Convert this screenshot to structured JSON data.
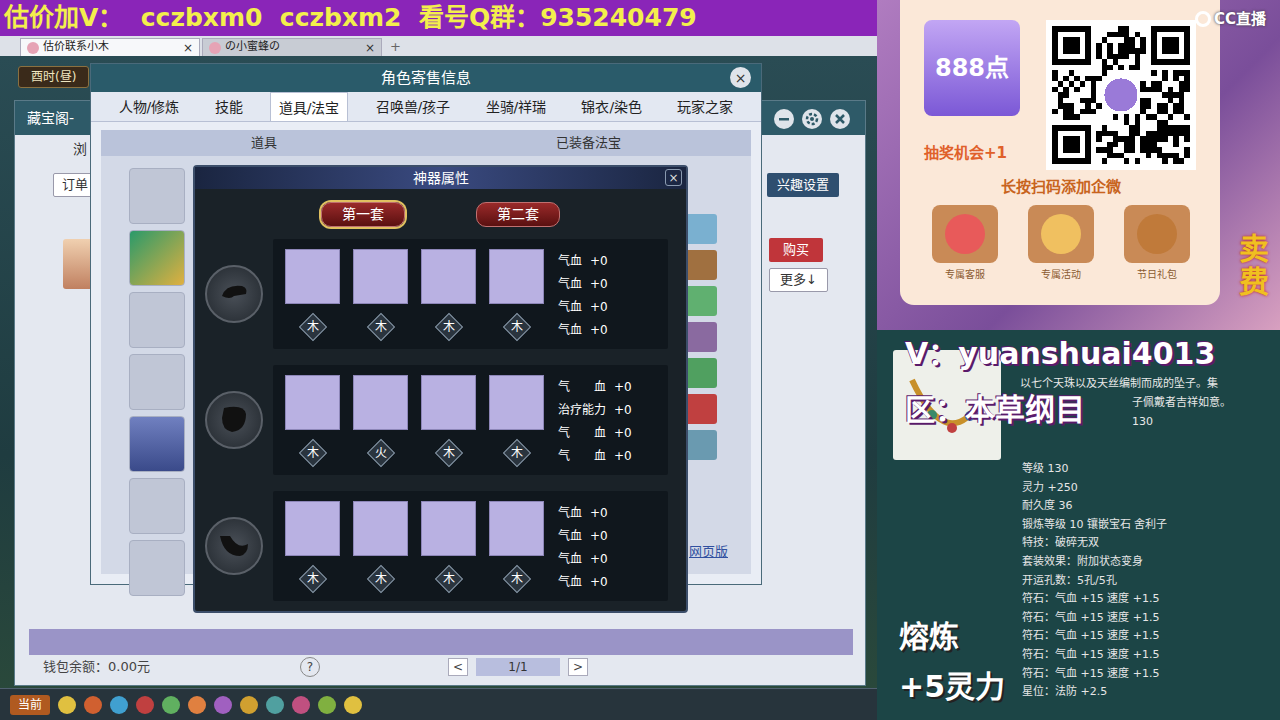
{
  "banner": {
    "text": "估价加V：  cczbxm0  cczbxm2  看号Q群：935240479"
  },
  "browser": {
    "tabs": [
      {
        "label": "估价联系小木",
        "close": "×",
        "selected": true
      },
      {
        "label": "の小蜜蜂の",
        "close": "×",
        "selected": false
      }
    ],
    "new_tab": "+"
  },
  "game": {
    "clock": "酉时(昼)",
    "shop_window": {
      "title": "藏宝阁-",
      "tab_partial": "浏",
      "order_button": "订单",
      "interest_button": "兴趣设置",
      "buy_button": "购买",
      "more_button": "更多↓",
      "wallet": "钱包余额：0.00元",
      "help": "?",
      "page": "1/1",
      "prev": "<",
      "next": ">"
    },
    "role_window": {
      "title": "角色寄售信息",
      "close": "×",
      "tabs": [
        {
          "label": "人物/修炼",
          "selected": false
        },
        {
          "label": "技能",
          "selected": false
        },
        {
          "label": "道具/法宝",
          "selected": true
        },
        {
          "label": "召唤兽/孩子",
          "selected": false
        },
        {
          "label": "坐骑/祥瑞",
          "selected": false
        },
        {
          "label": "锦衣/染色",
          "selected": false
        },
        {
          "label": "玩家之家",
          "selected": false
        }
      ],
      "columns": [
        "道具",
        "已装备法宝"
      ],
      "web_link": "网页版"
    },
    "artifact": {
      "title": "神器属性",
      "close": "×",
      "sets": [
        {
          "label": "第一套",
          "selected": true
        },
        {
          "label": "第二套",
          "selected": false
        }
      ],
      "rows": [
        {
          "slots": [
            "木",
            "木",
            "木",
            "木"
          ],
          "stats": [
            {
              "name": "气血",
              "value": "+0"
            },
            {
              "name": "气血",
              "value": "+0"
            },
            {
              "name": "气血",
              "value": "+0"
            },
            {
              "name": "气血",
              "value": "+0"
            }
          ]
        },
        {
          "slots": [
            "木",
            "火",
            "木",
            "木"
          ],
          "stats": [
            {
              "name": "气　　血",
              "value": "+0"
            },
            {
              "name": "治疗能力",
              "value": "+0"
            },
            {
              "name": "气　　血",
              "value": "+0"
            },
            {
              "name": "气　　血",
              "value": "+0"
            }
          ]
        },
        {
          "slots": [
            "木",
            "木",
            "木",
            "木"
          ],
          "stats": [
            {
              "name": "气血",
              "value": "+0"
            },
            {
              "name": "气血",
              "value": "+0"
            },
            {
              "name": "气血",
              "value": "+0"
            },
            {
              "name": "气血",
              "value": "+0"
            }
          ]
        }
      ]
    },
    "taskbar": {
      "label": "当前"
    }
  },
  "promo": {
    "brand": "CC直播",
    "points": "888点",
    "lottery": "抽奖机会+1",
    "scan_hint": "长按扫码添加企微",
    "shortcuts": [
      "专属客服",
      "专属活动",
      "节日礼包"
    ],
    "side_text": "卖费"
  },
  "stream": {
    "contact": "V：yuanshuai4013",
    "server": "区：本草纲目",
    "smelt": [
      "熔炼",
      "+5灵力"
    ]
  },
  "item": {
    "description": [
      "以七个天珠以及天丝编制而成的坠子。集",
      "子佩戴者吉祥如意。",
      "130"
    ],
    "lines": [
      "等级 130",
      "灵力 +250",
      "耐久度 36",
      "锻炼等级 10 镶嵌宝石 舍利子",
      "特技：破碎无双",
      "套装效果：附加状态变身",
      "开运孔数：5孔/5孔",
      "符石：气血 +15 速度 +1.5",
      "符石：气血 +15 速度 +1.5",
      "符石：气血 +15 速度 +1.5",
      "符石：气血 +15 速度 +1.5",
      "符石：气血 +15 速度 +1.5",
      "星位：法防 +2.5"
    ]
  }
}
